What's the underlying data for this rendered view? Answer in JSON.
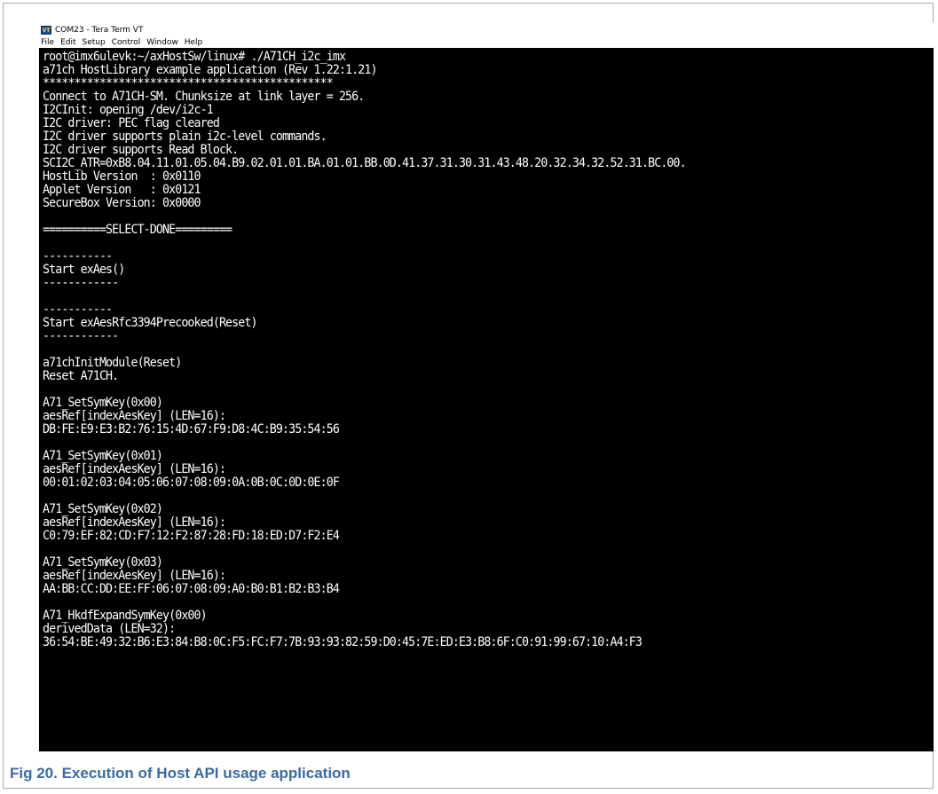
{
  "window": {
    "title": "COM23 - Tera Term VT",
    "icon_text": "VT",
    "menu": [
      "File",
      "Edit",
      "Setup",
      "Control",
      "Window",
      "Help"
    ]
  },
  "terminal": {
    "lines": [
      "root@imx6ulevk:~/axHostSw/linux# ./A71CH_i2c_imx",
      "a71ch HostLibrary example application (Rev 1.22:1.21)",
      "**********************************************",
      "Connect to A71CH-SM. Chunksize at link layer = 256.",
      "I2CInit: opening /dev/i2c-1",
      "I2C driver: PEC flag cleared",
      "I2C driver supports plain i2c-level commands.",
      "I2C driver supports Read Block.",
      "SCI2C_ATR=0xB8.04.11.01.05.04.B9.02.01.01.BA.01.01.BB.0D.41.37.31.30.31.43.48.20.32.34.32.52.31.BC.00.",
      "HostLib Version  : 0x0110",
      "Applet Version   : 0x0121",
      "SecureBox Version: 0x0000",
      "",
      "==========SELECT-DONE=========",
      "",
      "-----------",
      "Start exAes()",
      "------------",
      "",
      "-----------",
      "Start exAesRfc3394Precooked(Reset)",
      "------------",
      "",
      "a71chInitModule(Reset)",
      "Reset A71CH.",
      "",
      "A71_SetSymKey(0x00)",
      "aesRef[indexAesKey] (LEN=16):",
      "DB:FE:E9:E3:B2:76:15:4D:67:F9:D8:4C:B9:35:54:56",
      "",
      "A71_SetSymKey(0x01)",
      "aesRef[indexAesKey] (LEN=16):",
      "00:01:02:03:04:05:06:07:08:09:0A:0B:0C:0D:0E:0F",
      "",
      "A71_SetSymKey(0x02)",
      "aesRef[indexAesKey] (LEN=16):",
      "C0:79:EF:82:CD:F7:12:F2:87:28:FD:18:ED:D7:F2:E4",
      "",
      "A71_SetSymKey(0x03)",
      "aesRef[indexAesKey] (LEN=16):",
      "AA:BB:CC:DD:EE:FF:06:07:08:09:A0:B0:B1:B2:B3:B4",
      "",
      "A71_HkdfExpandSymKey(0x00)",
      "derivedData (LEN=32):",
      "36:54:BE:49:32:B6:E3:84:B8:0C:F5:FC:F7:7B:93:93:82:59:D0:45:7E:ED:E3:B8:6F:C0:91:99:67:10:A4:F3"
    ]
  },
  "caption": "Fig 20. Execution of Host API usage application"
}
